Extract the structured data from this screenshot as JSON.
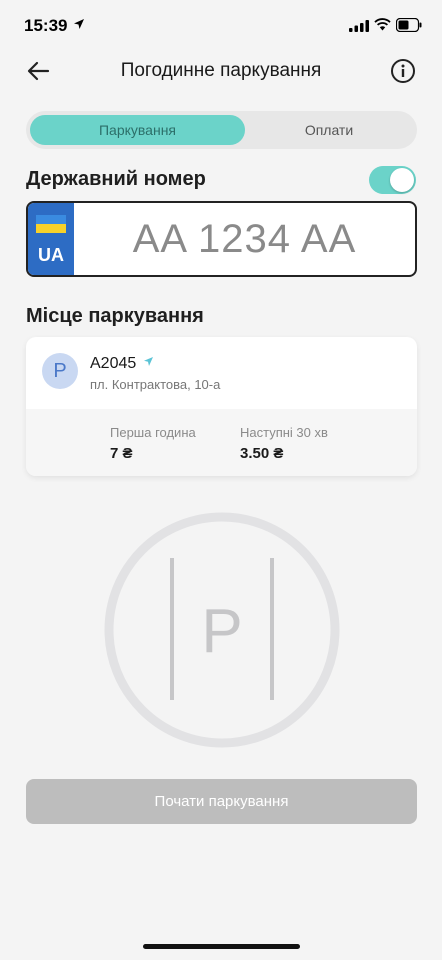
{
  "status_bar": {
    "time": "15:39"
  },
  "header": {
    "title": "Погодинне паркування",
    "back_icon": "arrow-left-icon",
    "info_icon": "info-icon"
  },
  "tabs": [
    {
      "label": "Паркування",
      "active": true
    },
    {
      "label": "Оплати",
      "active": false
    }
  ],
  "plate_section": {
    "label": "Державний номер",
    "toggle_on": true,
    "plate": {
      "country": "UA",
      "number": "AA 1234 AA"
    }
  },
  "place_section": {
    "label": "Місце паркування",
    "avatar_letter": "P",
    "code": "A2045",
    "address": "пл. Контрактова, 10-а",
    "first_hour": {
      "label": "Перша година",
      "value": "7 ₴"
    },
    "next_30": {
      "label": "Наступні 30 хв",
      "value": "3.50 ₴"
    }
  },
  "sign": {
    "letter": "P"
  },
  "start_button": {
    "label": "Почати паркування"
  },
  "colors": {
    "accent": "#6bd3c9",
    "plate_strip": "#2d6cc4",
    "button_disabled": "#bdbdbd"
  }
}
